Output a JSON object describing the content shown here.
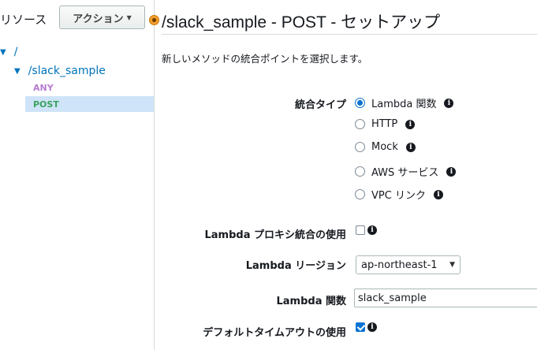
{
  "sidebar": {
    "resources_label": "リソース",
    "actions_button": "アクション",
    "tree": {
      "root": "/",
      "slack_sample": "/slack_sample",
      "any": "ANY",
      "post": "POST"
    }
  },
  "main": {
    "title": "/slack_sample - POST - セットアップ",
    "description": "新しいメソッドの統合ポイントを選択します。",
    "integration_type": {
      "label": "統合タイプ",
      "options": [
        "Lambda 関数",
        "HTTP",
        "Mock",
        "AWS サービス",
        "VPC リンク"
      ],
      "selected": "Lambda 関数"
    },
    "lambda_proxy": {
      "label": "Lambda プロキシ統合の使用",
      "checked": false
    },
    "lambda_region": {
      "label": "Lambda リージョン",
      "value": "ap-northeast-1"
    },
    "lambda_function": {
      "label": "Lambda 関数",
      "value": "slack_sample"
    },
    "default_timeout": {
      "label": "デフォルトタイムアウトの使用",
      "checked": true
    }
  },
  "colors": {
    "link": "#0073bb",
    "any_method": "#b67dd1",
    "post_method": "#3aa35f",
    "selected_row": "#cfe4f8",
    "accent": "#0972d3"
  }
}
